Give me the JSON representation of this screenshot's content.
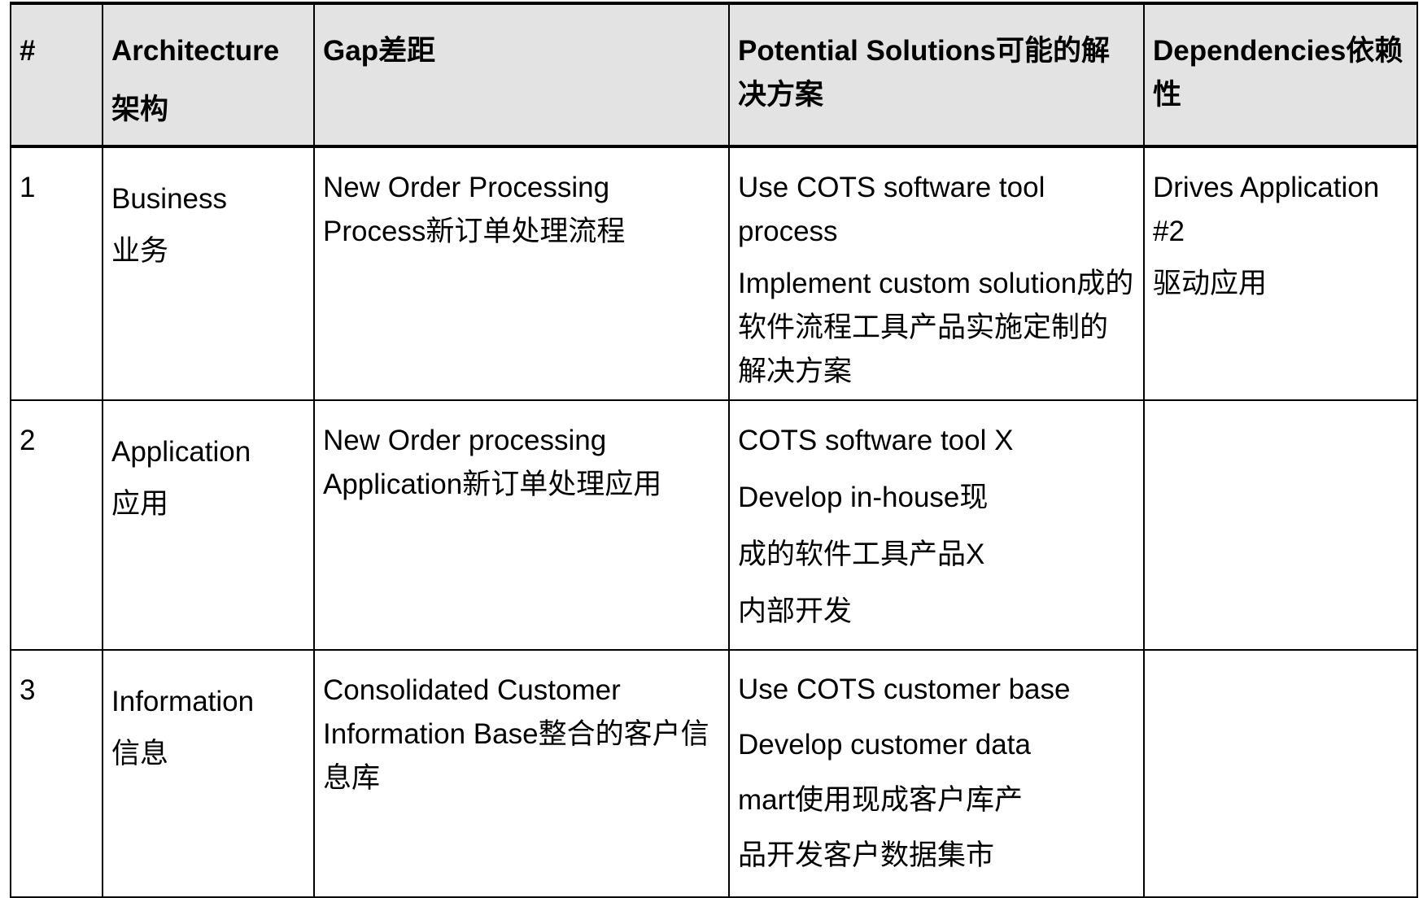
{
  "headers": {
    "num": "#",
    "architecture": [
      "Architecture",
      "架构"
    ],
    "gap": "Gap差距",
    "solutions": "Potential Solutions可能的解决方案",
    "dependencies": "Dependencies依赖性"
  },
  "rows": [
    {
      "num": "1",
      "architecture": [
        "Business",
        "业务"
      ],
      "gap": "New Order Processing Process新订单处理流程",
      "solutions": [
        "Use COTS software tool process",
        "Implement custom solution成的软件流程工具产品实施定制的解决方案"
      ],
      "dependencies": [
        "Drives Application #2",
        "驱动应用"
      ]
    },
    {
      "num": "2",
      "architecture": [
        "Application",
        "应用"
      ],
      "gap": "New Order processing Application新订单处理应用",
      "solutions": [
        "COTS software tool X",
        "Develop in-house现",
        "成的软件工具产品X",
        "内部开发"
      ],
      "dependencies": []
    },
    {
      "num": "3",
      "architecture": [
        "Information",
        "信息"
      ],
      "gap": "Consolidated Customer Information Base整合的客户信息库",
      "solutions": [
        "Use COTS customer base",
        "Develop customer data",
        "mart使用现成客户库产",
        "品开发客户数据集市"
      ],
      "dependencies": []
    }
  ]
}
